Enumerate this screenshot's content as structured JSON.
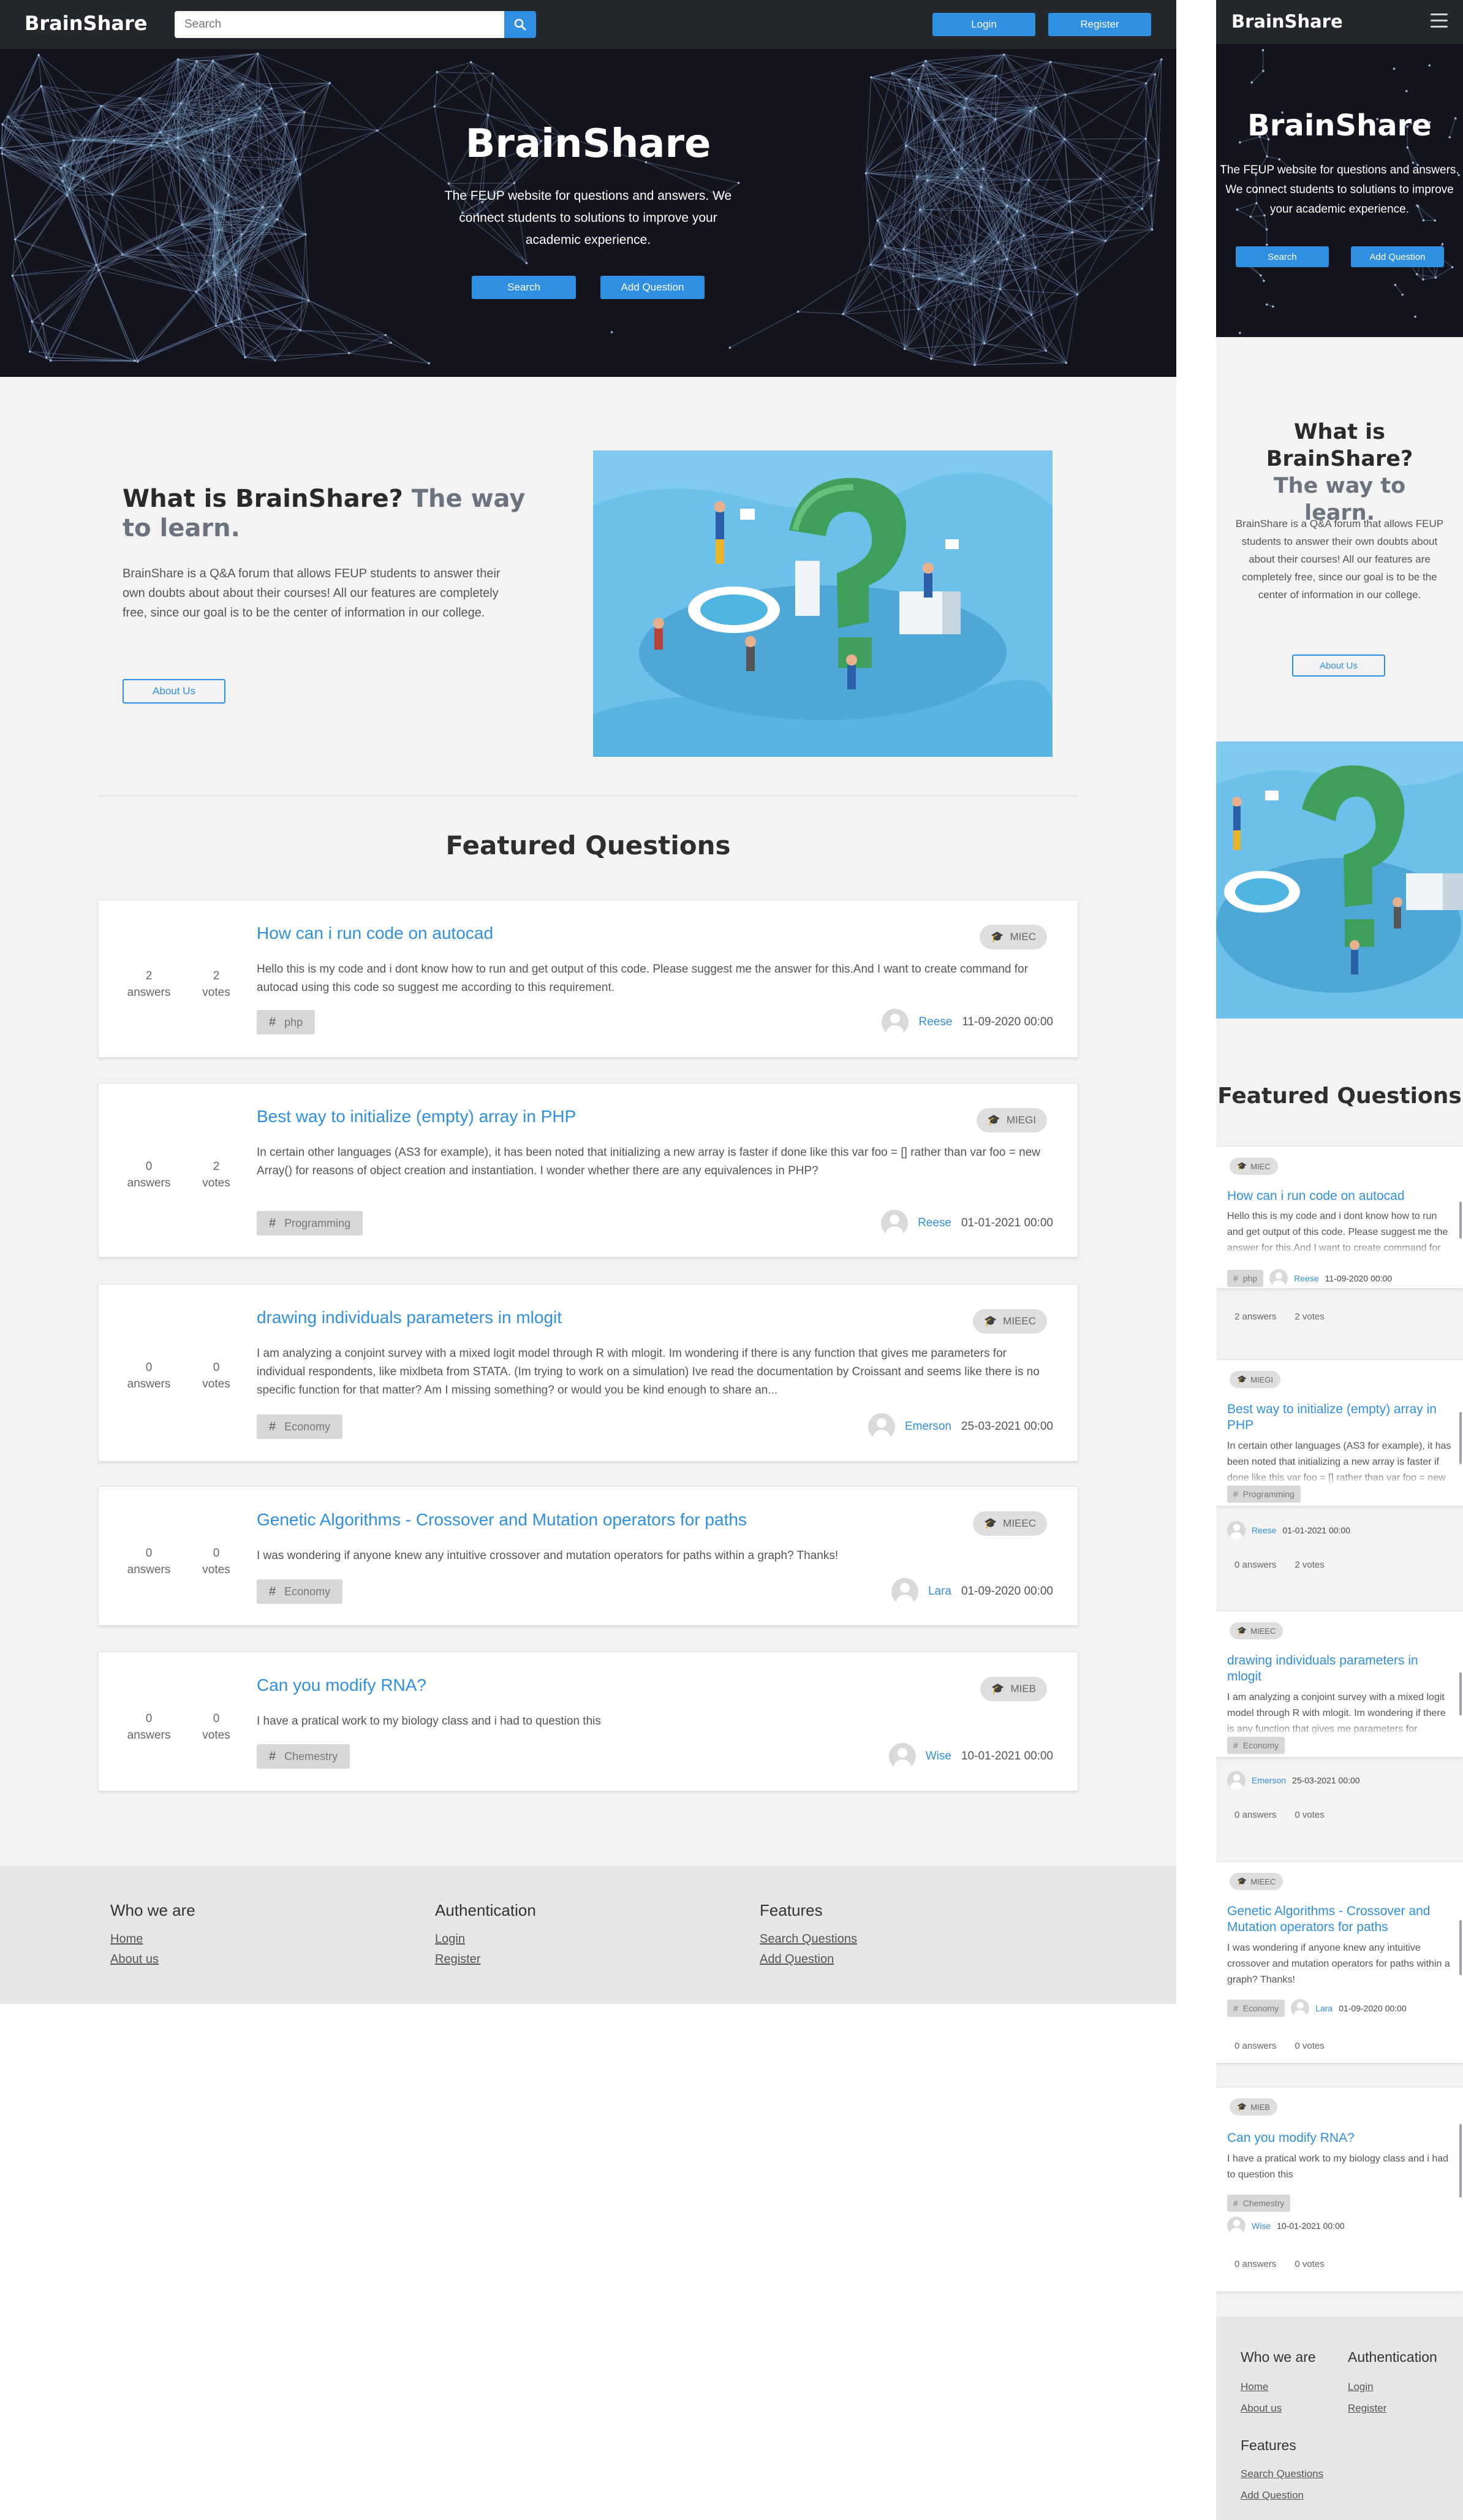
{
  "brand": "BrainShare",
  "nav": {
    "search_placeholder": "Search",
    "login_label": "Login",
    "register_label": "Register",
    "search_icon": "search-icon",
    "menu_icon": "hamburger-menu-icon"
  },
  "hero": {
    "title": "BrainShare",
    "subtitle": "The FEUP website for questions and answers. We connect students to solutions to improve your academic experience.",
    "search_label": "Search",
    "add_question_label": "Add Question"
  },
  "about": {
    "title_main": "What is BrainShare?",
    "title_accent": "The way to learn.",
    "text": "BrainShare is a Q&A forum that allows FEUP students to answer their own doubts about about their courses! All our features are completely free, since our goal is to be the center of information in our college.",
    "button_label": "About Us"
  },
  "featured": {
    "title": "Featured Questions",
    "answers_label": "answers",
    "votes_label": "votes",
    "questions": [
      {
        "answers": "2",
        "votes": "2",
        "title": "How can i run code on autocad",
        "body": "Hello this is my code and i dont know how to run and get output of this code. Please suggest me the answer for this.And I want to create command for autocad using this code so suggest me according to this requirement.",
        "tag": "php",
        "course": "MIEC",
        "author": "Reese",
        "date": "11-09-2020 00:00"
      },
      {
        "answers": "0",
        "votes": "2",
        "title": "Best way to initialize (empty) array in PHP",
        "body": "In certain other languages (AS3 for example), it has been noted that initializing a new array is faster if done like this var foo = [] rather than var foo = new Array() for reasons of object creation and instantiation. I wonder whether there are any equivalences in PHP?",
        "tag": "Programming",
        "course": "MIEGI",
        "author": "Reese",
        "date": "01-01-2021 00:00"
      },
      {
        "answers": "0",
        "votes": "0",
        "title": "drawing individuals parameters in mlogit",
        "body": "I am analyzing a conjoint survey with a mixed logit model through R with mlogit. Im wondering if there is any function that gives me parameters for individual respondents, like mixlbeta from STATA. (Im trying to work on a simulation) Ive read the documentation by Croissant and seems like there is no specific function for that matter? Am I missing something? or would you be kind enough to share an...",
        "tag": "Economy",
        "course": "MIEEC",
        "author": "Emerson",
        "date": "25-03-2021 00:00"
      },
      {
        "answers": "0",
        "votes": "0",
        "title": "Genetic Algorithms - Crossover and Mutation operators for paths",
        "body": "I was wondering if anyone knew any intuitive crossover and mutation operators for paths within a graph? Thanks!",
        "tag": "Economy",
        "course": "MIEEC",
        "author": "Lara",
        "date": "01-09-2020 00:00"
      },
      {
        "answers": "0",
        "votes": "0",
        "title": "Can you modify RNA?",
        "body": "I have a pratical work to my biology class and i had to question this",
        "tag": "Chemestry",
        "course": "MIEB",
        "author": "Wise",
        "date": "10-01-2021 00:00"
      }
    ]
  },
  "footer": {
    "who_head": "Who we are",
    "home": "Home",
    "about": "About us",
    "auth_head": "Authentication",
    "login": "Login",
    "register": "Register",
    "features_head": "Features",
    "search_questions": "Search Questions",
    "add_question": "Add Question"
  },
  "colors": {
    "accent": "#2f8fe0",
    "navbar": "#24282c",
    "hero_bg": "#14141f",
    "page_bg": "#f3f3f3"
  }
}
